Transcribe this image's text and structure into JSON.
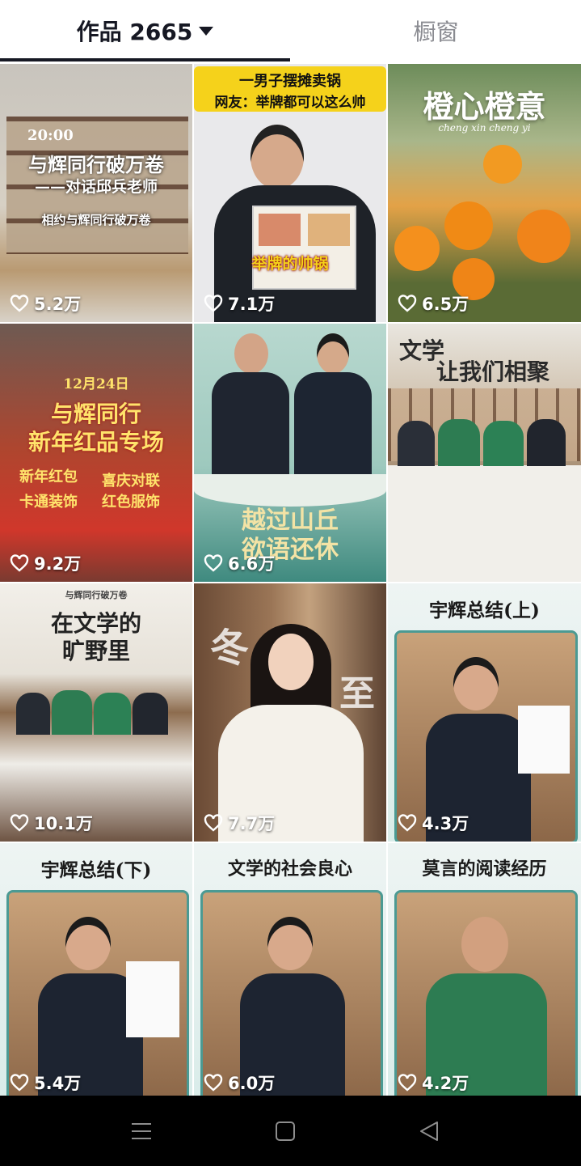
{
  "tabs": {
    "works_label": "作品 2665",
    "showcase_label": "橱窗"
  },
  "videos": [
    {
      "likes": "5.2万",
      "captions": [
        "20:00",
        "与辉同行破万卷",
        "——对话邱兵老师",
        "相约与辉同行破万卷"
      ]
    },
    {
      "likes": "7.1万",
      "captions": [
        "一男子摆摊卖锅",
        "网友：举牌都可以这么帅",
        "举牌的帅锅"
      ]
    },
    {
      "likes": "6.5万",
      "captions": [
        "橙心橙意",
        "cheng xin cheng yi"
      ]
    },
    {
      "likes": "9.2万",
      "captions": [
        "12月24日",
        "与辉同行",
        "新年红品专场",
        "新年红包",
        "喜庆对联",
        "卡通装饰",
        "红色服饰"
      ]
    },
    {
      "likes": "6.6万",
      "captions": [
        "越过山丘",
        "欲语还休"
      ]
    },
    {
      "likes": "",
      "captions": [
        "文学",
        "让我们相聚"
      ]
    },
    {
      "likes": "10.1万",
      "captions": [
        "与辉同行破万卷",
        "在文学的",
        "旷野里"
      ]
    },
    {
      "likes": "7.7万",
      "captions": [
        "冬",
        "至"
      ]
    },
    {
      "likes": "4.3万",
      "captions": [
        "宇辉总结(上)"
      ]
    },
    {
      "likes": "5.4万",
      "captions": [
        "宇辉总结(下)"
      ]
    },
    {
      "likes": "6.0万",
      "captions": [
        "文学的社会良心"
      ]
    },
    {
      "likes": "4.2万",
      "captions": [
        "莫言的阅读经历"
      ]
    }
  ],
  "colors": {
    "accent_yellow": "#f5d21b",
    "banner_teal": "#4b9a93",
    "header_text": "#161823"
  },
  "icons": {
    "heart": "heart-icon",
    "menu": "menu-icon",
    "home": "home-icon",
    "back": "back-icon"
  }
}
